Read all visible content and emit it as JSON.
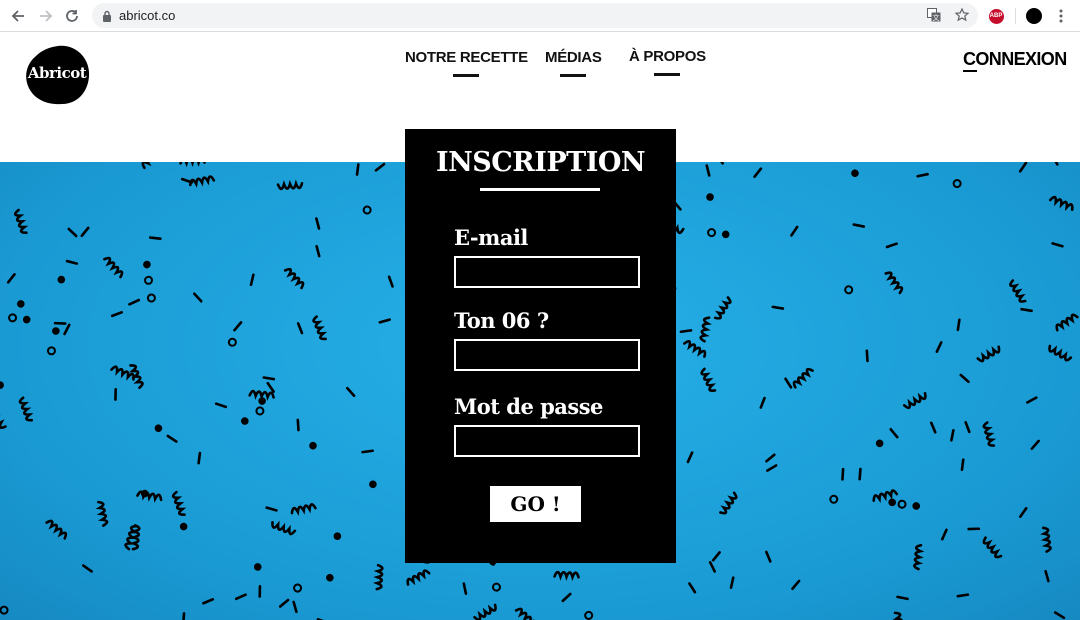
{
  "browser": {
    "url": "abricot.co",
    "icons": [
      "back-icon",
      "forward-icon",
      "reload-icon",
      "lock-icon",
      "translate-icon",
      "star-icon",
      "adblock-icon",
      "profile-icon",
      "menu-icon"
    ],
    "adblock_label": "ABP"
  },
  "site": {
    "logo_text": "Abricot",
    "nav": [
      {
        "label": "NOTRE RECETTE"
      },
      {
        "label": "MÉDIAS"
      },
      {
        "label": "À PROPOS"
      }
    ],
    "login_label": "CONNEXION"
  },
  "form": {
    "title": "INSCRIPTION",
    "fields": [
      {
        "label": "E-mail",
        "value": ""
      },
      {
        "label": "Ton 06 ?",
        "value": ""
      },
      {
        "label": "Mot de passe",
        "value": ""
      }
    ],
    "submit_label": "GO !"
  },
  "colors": {
    "band_blue": "#1fa3dc",
    "card_black": "#000000",
    "text_white": "#ffffff"
  }
}
